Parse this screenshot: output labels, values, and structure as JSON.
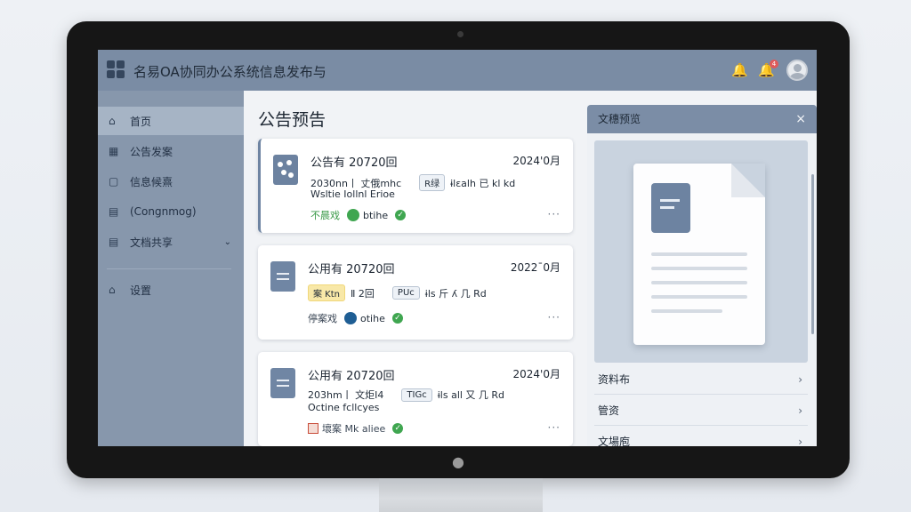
{
  "header": {
    "title": "名易OA协同办公系统信息发布与",
    "icons": [
      "bell-icon",
      "notification-bell-icon",
      "avatar"
    ],
    "badge_count": "4"
  },
  "sidebar": {
    "items": [
      {
        "label": "首页",
        "icon": "home-icon",
        "active": true
      },
      {
        "label": "公告发案",
        "icon": "grid-icon"
      },
      {
        "label": "信息候熹",
        "icon": "folder-icon"
      },
      {
        "label": "(Congnmog)",
        "icon": "document-icon"
      },
      {
        "label": "文档共享",
        "icon": "document-icon",
        "chevron": "⌄"
      },
      {
        "label": "设置",
        "icon": "home-icon"
      }
    ]
  },
  "main": {
    "title": "公告预告",
    "cards": [
      {
        "title": "公告有 20720回",
        "date": "2024'0月",
        "line2_a": "2030nn丨 丈俄mhc",
        "tag": "R绿",
        "line2_b": "ɨlɛalh 已 kl kd",
        "line3": "Wsltie Iollnl Erioe",
        "status": "不晨戏",
        "pill": "btihe",
        "more": "···"
      },
      {
        "title": "公用有 20720回",
        "date": "2022ˉ0月",
        "tag_yellow": "案 Ktn",
        "line2_a": "Ⅱ 2回",
        "tag": "PUc",
        "line2_b": "ɨls 斤 ʎ 几 Rd",
        "status": "停案戏",
        "pill": "otihe",
        "more": "···"
      },
      {
        "title": "公用有 20720回",
        "date": "2024'0月",
        "line2_a": "203hm丨 文炬I4",
        "tag": "TIGc",
        "line2_b": "ɨls all 又 几 Rd",
        "line3": "Octine fcllcyes",
        "status": "壞案 Mk aliee",
        "more": "···"
      }
    ]
  },
  "panel": {
    "title": "文穗预览",
    "close": "×",
    "items": [
      {
        "label": "资料布"
      },
      {
        "label": "管资"
      },
      {
        "label": "文場庖"
      }
    ]
  }
}
